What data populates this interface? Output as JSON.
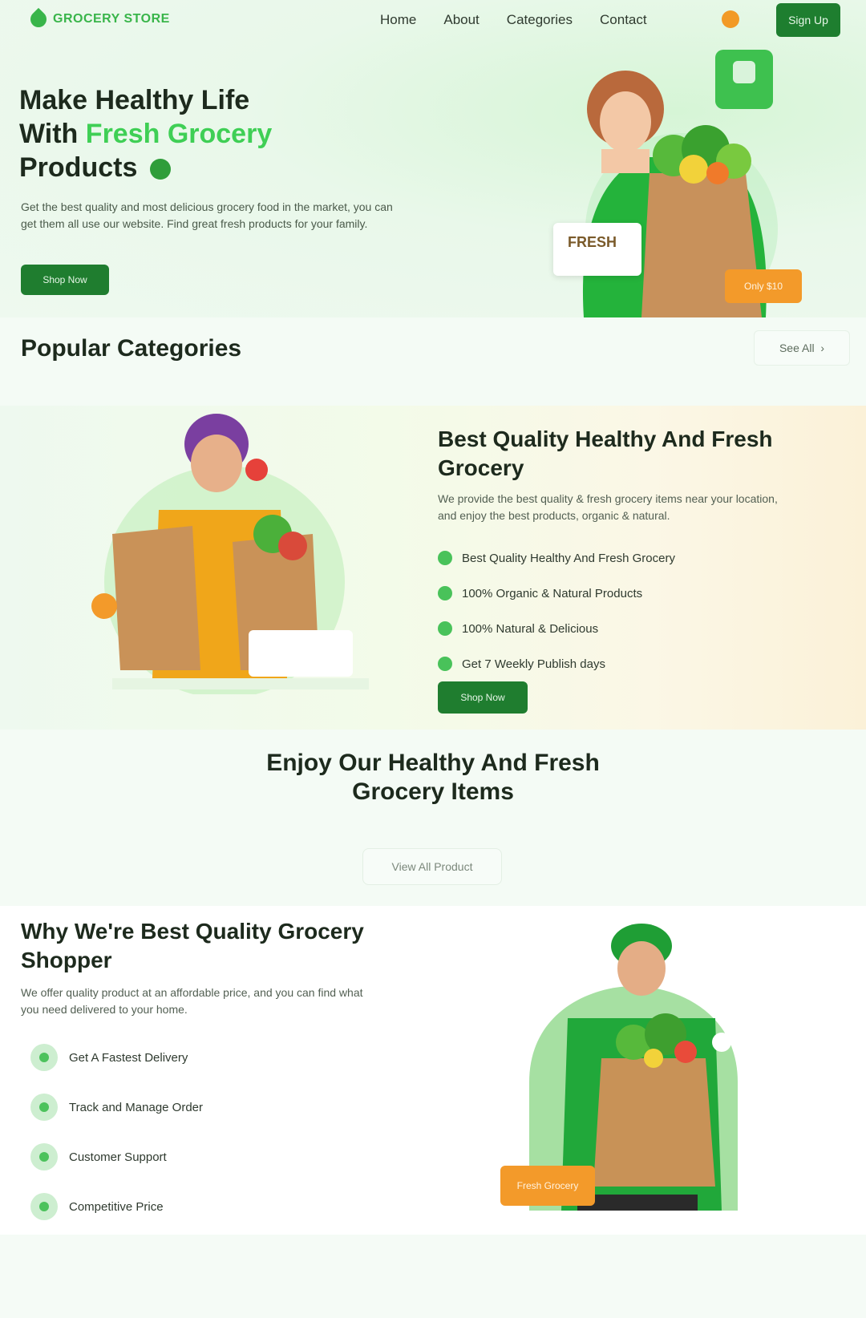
{
  "brand": {
    "name": "GROCERY STORE"
  },
  "nav": {
    "links": [
      "Home",
      "About",
      "Categories",
      "Contact"
    ],
    "signup_label": "Sign Up"
  },
  "hero": {
    "title_line1": "Make Healthy Life",
    "title_with": "With",
    "title_accent": "Fresh Grocery",
    "title_line3": "Products",
    "description": "Get the best quality and most delicious grocery food in the market, you can get them all use our website. Find great fresh products for your family.",
    "cta_label": "Shop Now",
    "promo_brand": "FRESH",
    "price_tag": "Only $10"
  },
  "categories": {
    "title": "Popular Categories",
    "see_all_label": "See All"
  },
  "quality": {
    "title": "Best Quality Healthy And Fresh Grocery",
    "description": "We provide the best quality & fresh grocery items near your location, and enjoy the best products, organic & natural.",
    "items": [
      "Best Quality Healthy And Fresh Grocery",
      "100% Organic & Natural Products",
      "100% Natural & Delicious",
      "Get 7 Weekly Publish days"
    ],
    "cta_label": "Shop Now"
  },
  "enjoy": {
    "title": "Enjoy Our Healthy And Fresh Grocery Items",
    "view_all_label": "View All Product"
  },
  "why": {
    "title": "Why We're Best Quality Grocery Shopper",
    "description": "We offer quality product at an affordable price, and you can find what you need delivered to your home.",
    "items": [
      "Get A Fastest Delivery",
      "Track and Manage Order",
      "Customer Support",
      "Competitive Price"
    ],
    "badge_label": "Fresh Grocery"
  },
  "colors": {
    "primary": "#1f7d2f",
    "accent_green": "#3fcf55",
    "orange": "#f39a2a"
  }
}
